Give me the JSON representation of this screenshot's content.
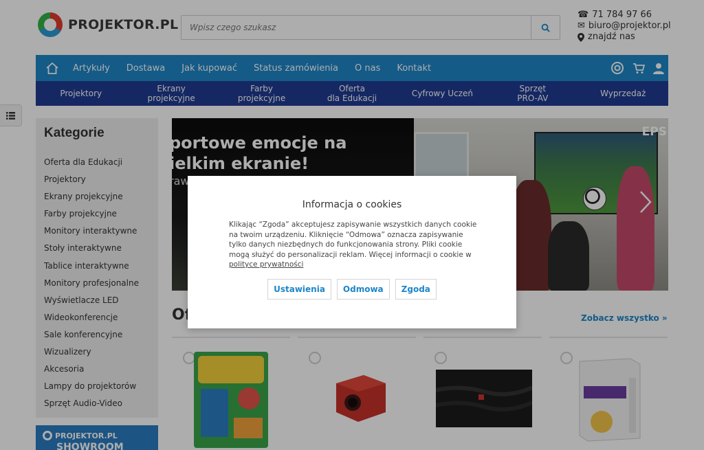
{
  "header": {
    "logo_text": "PROJEKTOR.PL",
    "search_placeholder": "Wpisz czego szukasz",
    "phone": "71 784 97 66",
    "email": "biuro@projektor.pl",
    "find_us": "znajdź nas"
  },
  "main_nav": [
    "Artykuły",
    "Dostawa",
    "Jak kupować",
    "Status zamówienia",
    "O nas",
    "Kontakt"
  ],
  "category_nav": [
    "Projektory",
    "Ekrany\nprojekcyjne",
    "Farby\nprojekcyjne",
    "Oferta\ndla Edukacji",
    "Cyfrowy Uczeń",
    "Sprzęt\nPRO-AV",
    "Wyprzedaż"
  ],
  "sidebar": {
    "title": "Kategorie",
    "items": [
      "Oferta dla Edukacji",
      "Projektory",
      "Ekrany projekcyjne",
      "Farby projekcyjne",
      "Monitory interaktywne",
      "Stoły interaktywne",
      "Tablice interaktywne",
      "Monitory profesjonalne",
      "Wyświetlacze LED",
      "Wideokonferencje",
      "Sale konferencyjne",
      "Wizualizery",
      "Akcesoria",
      "Lampy do projektorów",
      "Sprzęt Audio-Video"
    ]
  },
  "showroom": {
    "brand": "PROJEKTOR.PL",
    "label": "SHOWROOM"
  },
  "banner": {
    "line1": "portowe emocje na",
    "line2": "ielkim ekranie!",
    "line3": "raw",
    "brand": "EPS"
  },
  "offers": {
    "title": "Ofe",
    "see_all": "Zobacz wszystko »"
  },
  "cookie": {
    "title": "Informacja o cookies",
    "message": "Klikając “Zgoda” akceptujesz zapisywanie wszystkich danych cookie na twoim urządzeniu. Kliknięcie “Odmowa” oznacza zapisywanie tylko danych niezbędnych do funkcjonowania strony. Pliki cookie mogą służyć do personalizacji reklam. Więcej informacji o cookie w ",
    "link": "polityce prywatności",
    "buttons": {
      "settings": "Ustawienia",
      "reject": "Odmowa",
      "accept": "Zgoda"
    }
  },
  "colors": {
    "main_nav": "#1e86c8",
    "category_nav": "#1f3c93",
    "accent": "#1e86c8"
  }
}
